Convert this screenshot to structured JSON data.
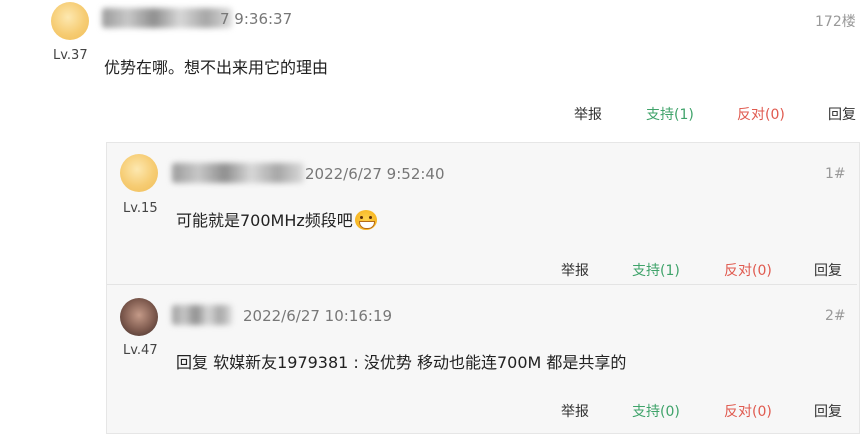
{
  "main_post": {
    "time": "7 9:36:37",
    "floor": "172楼",
    "level": "Lv.37",
    "content": "优势在哪。想不出来用它的理由",
    "actions": {
      "report": "举报",
      "support": "支持(1)",
      "oppose": "反对(0)",
      "reply": "回复"
    }
  },
  "replies": [
    {
      "time": "2022/6/27 9:52:40",
      "floor": "1#",
      "level": "Lv.15",
      "content": "可能就是700MHz频段吧",
      "emoji": "laughing-emoji",
      "actions": {
        "report": "举报",
        "support": "支持(1)",
        "oppose": "反对(0)",
        "reply": "回复"
      }
    },
    {
      "time": "2022/6/27 10:16:19",
      "floor": "2#",
      "level": "Lv.47",
      "content": "回复 软媒新友1979381 : 没优势 移动也能连700M 都是共享的",
      "actions": {
        "report": "举报",
        "support": "支持(0)",
        "oppose": "反对(0)",
        "reply": "回复"
      }
    }
  ],
  "colors": {
    "support": "#3fa36a",
    "oppose": "#e05a4f",
    "reply_bg": "#f7f7f7"
  }
}
